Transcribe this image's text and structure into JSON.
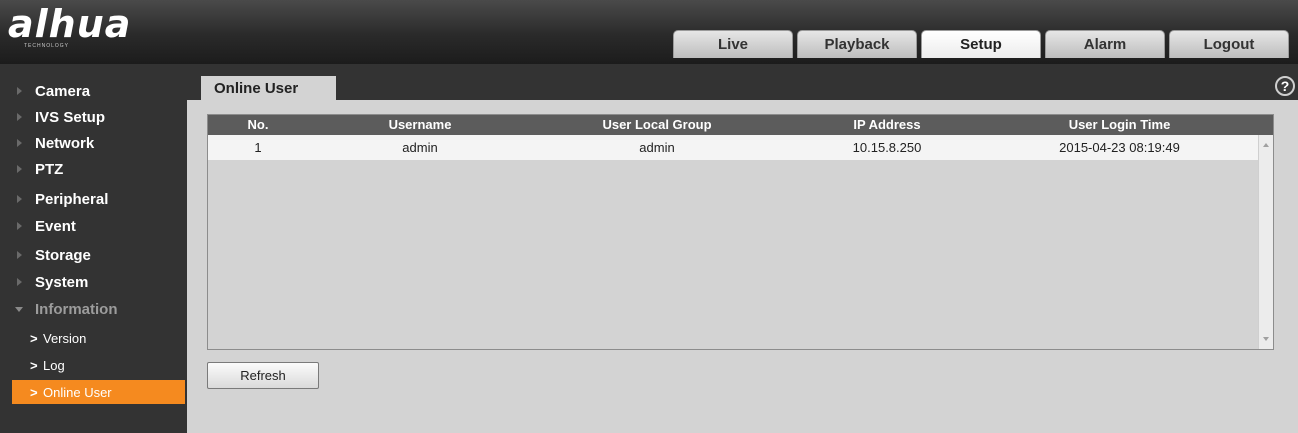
{
  "brand": {
    "name": "alhua",
    "sub": "TECHNOLOGY"
  },
  "nav": {
    "tabs": [
      {
        "label": "Live"
      },
      {
        "label": "Playback"
      },
      {
        "label": "Setup",
        "active": true
      },
      {
        "label": "Alarm"
      },
      {
        "label": "Logout"
      }
    ]
  },
  "sidebar": {
    "items": [
      {
        "label": "Camera"
      },
      {
        "label": "IVS Setup"
      },
      {
        "label": "Network"
      },
      {
        "label": "PTZ"
      },
      {
        "label": "Peripheral"
      },
      {
        "label": "Event"
      },
      {
        "label": "Storage"
      },
      {
        "label": "System"
      },
      {
        "label": "Information",
        "expanded": true
      }
    ],
    "subitems": [
      {
        "label": "Version"
      },
      {
        "label": "Log"
      },
      {
        "label": "Online User",
        "active": true
      }
    ]
  },
  "page": {
    "tab_title": "Online User",
    "help_glyph": "?"
  },
  "table": {
    "columns": [
      "No.",
      "Username",
      "User Local Group",
      "IP Address",
      "User Login Time"
    ],
    "rows": [
      [
        "1",
        "admin",
        "admin",
        "10.15.8.250",
        "2015-04-23 08:19:49"
      ]
    ]
  },
  "buttons": {
    "refresh": "Refresh"
  },
  "colors": {
    "accent": "#f58a1f",
    "sidebar_bg": "#333333",
    "content_bg": "#d3d3d3",
    "table_header": "#5c5c5c"
  }
}
